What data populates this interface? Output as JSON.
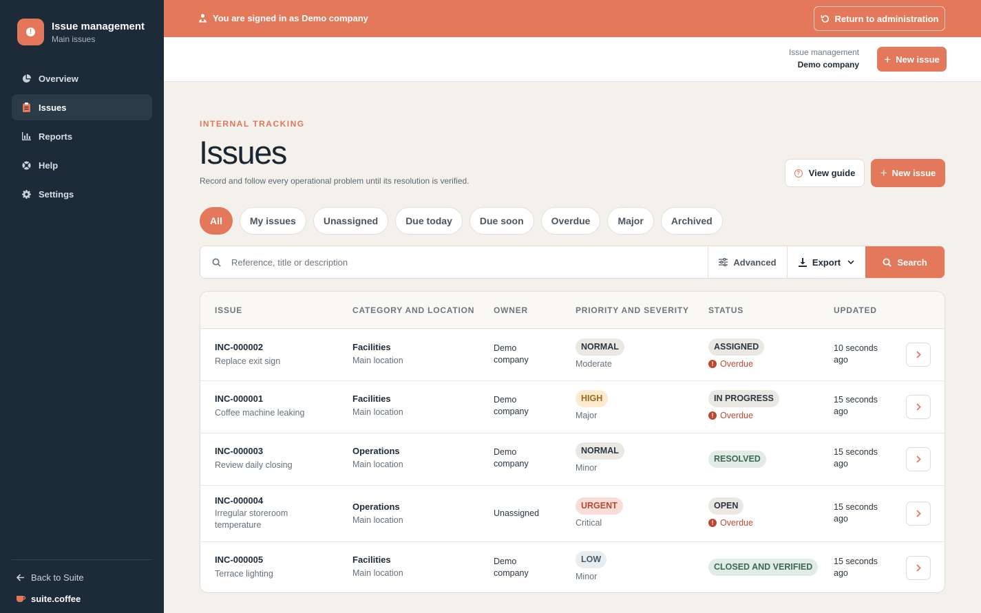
{
  "sidebar": {
    "brand_title": "Issue management",
    "brand_subtitle": "Main issues",
    "items": [
      {
        "label": "Overview",
        "icon": "pie-chart-icon"
      },
      {
        "label": "Issues",
        "icon": "clipboard-icon",
        "active": true
      },
      {
        "label": "Reports",
        "icon": "bar-chart-icon"
      },
      {
        "label": "Help",
        "icon": "lifebuoy-icon"
      },
      {
        "label": "Settings",
        "icon": "gear-icon"
      }
    ],
    "back_label": "Back to Suite",
    "suite_label": "suite.coffee"
  },
  "banner": {
    "text": "You are signed in as Demo company",
    "return_label": "Return to administration"
  },
  "header": {
    "app_label": "Issue management",
    "company": "Demo company",
    "new_issue_label": "New issue"
  },
  "page": {
    "eyebrow": "INTERNAL TRACKING",
    "title": "Issues",
    "subtitle": "Record and follow every operational problem until its resolution is verified.",
    "guide_label": "View guide",
    "new_issue_label": "New issue"
  },
  "filters": [
    "All",
    "My issues",
    "Unassigned",
    "Due today",
    "Due soon",
    "Overdue",
    "Major",
    "Archived"
  ],
  "search": {
    "placeholder": "Reference, title or description",
    "value": "",
    "advanced_label": "Advanced",
    "export_label": "Export",
    "search_label": "Search"
  },
  "table": {
    "columns": [
      "ISSUE",
      "CATEGORY AND LOCATION",
      "OWNER",
      "PRIORITY AND SEVERITY",
      "STATUS",
      "UPDATED"
    ],
    "rows": [
      {
        "ref": "INC-000002",
        "title": "Replace exit sign",
        "category": "Facilities",
        "location": "Main location",
        "owner": "Demo company",
        "priority": "NORMAL",
        "severity": "Moderate",
        "status": "ASSIGNED",
        "overdue": "Overdue",
        "updated": "10 seconds ago"
      },
      {
        "ref": "INC-000001",
        "title": "Coffee machine leaking",
        "category": "Facilities",
        "location": "Main location",
        "owner": "Demo company",
        "priority": "HIGH",
        "severity": "Major",
        "status": "IN PROGRESS",
        "overdue": "Overdue",
        "updated": "15 seconds ago"
      },
      {
        "ref": "INC-000003",
        "title": "Review daily closing",
        "category": "Operations",
        "location": "Main location",
        "owner": "Demo company",
        "priority": "NORMAL",
        "severity": "Minor",
        "status": "RESOLVED",
        "overdue": "",
        "updated": "15 seconds ago"
      },
      {
        "ref": "INC-000004",
        "title": "Irregular storeroom temperature",
        "category": "Operations",
        "location": "Main location",
        "owner": "Unassigned",
        "priority": "URGENT",
        "severity": "Critical",
        "status": "OPEN",
        "overdue": "Overdue",
        "updated": "15 seconds ago"
      },
      {
        "ref": "INC-000005",
        "title": "Terrace lighting",
        "category": "Facilities",
        "location": "Main location",
        "owner": "Demo company",
        "priority": "LOW",
        "severity": "Minor",
        "status": "CLOSED AND VERIFIED",
        "overdue": "",
        "updated": "15 seconds ago"
      }
    ]
  },
  "colors": {
    "accent": "#e4785b",
    "sidebar": "#1d2b38",
    "background": "#f4f1ec"
  }
}
